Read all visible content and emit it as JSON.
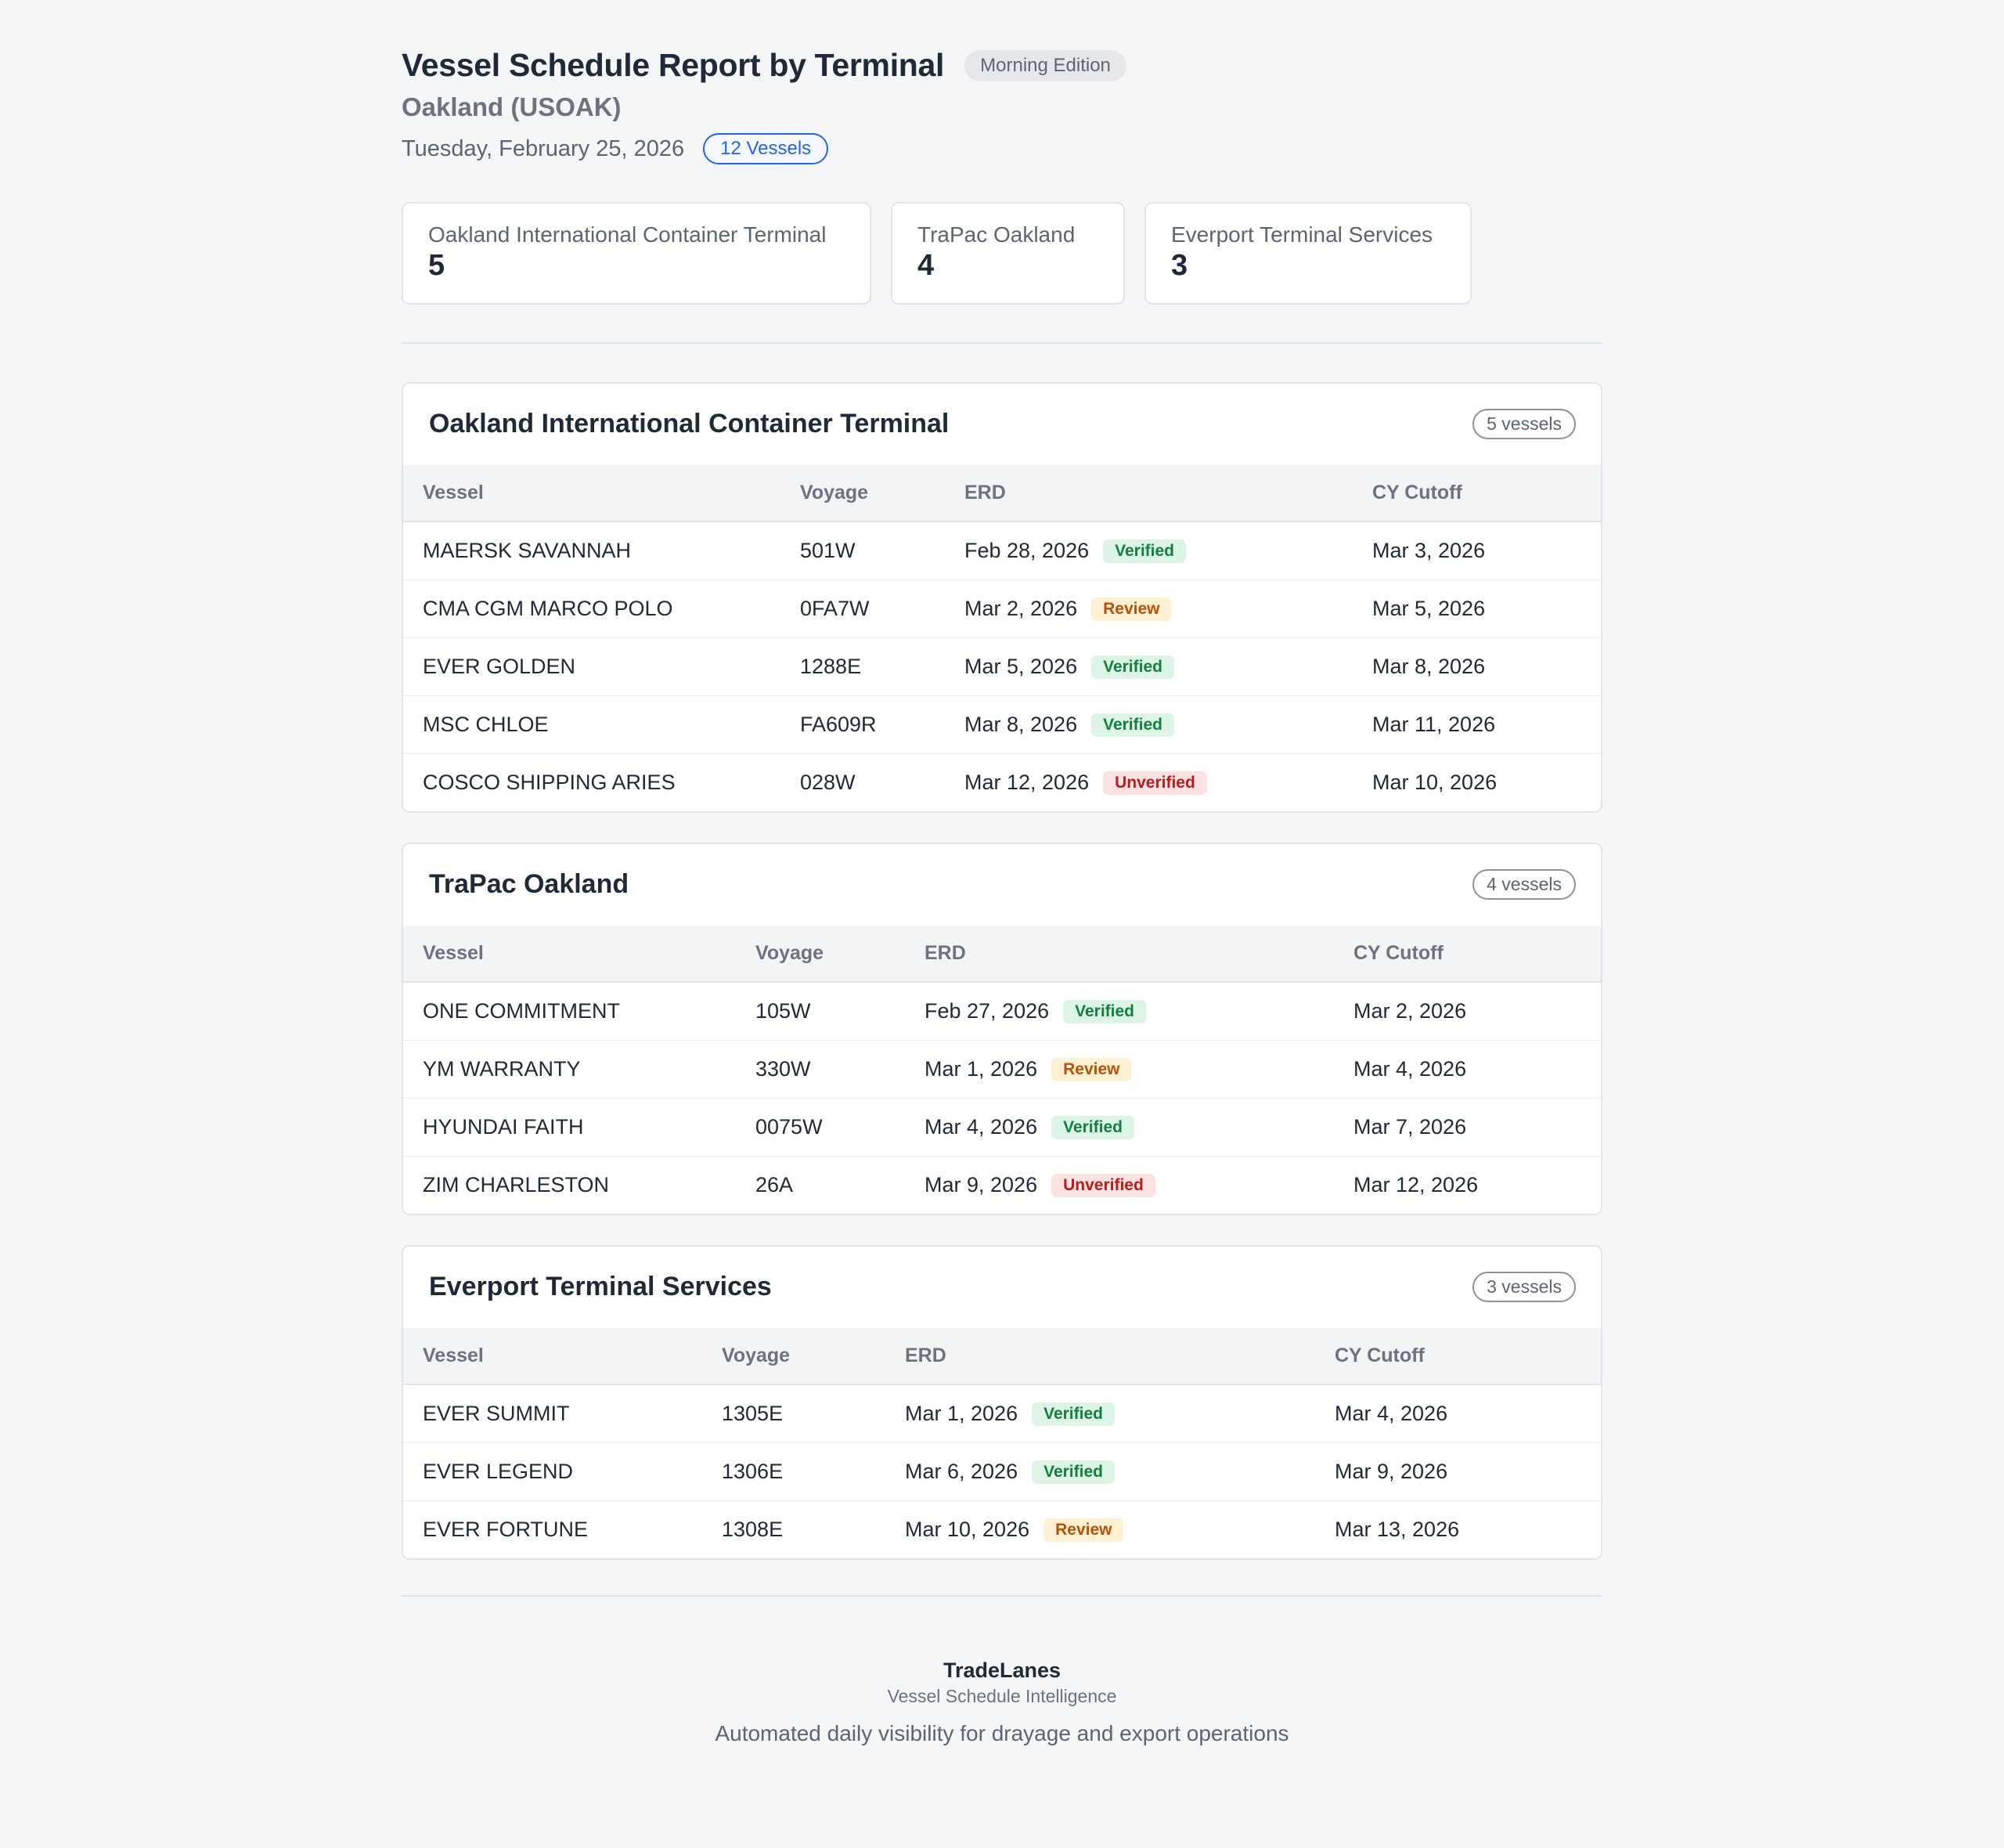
{
  "header": {
    "title": "Vessel Schedule Report by Terminal",
    "edition": "Morning Edition",
    "port": "Oakland (USOAK)",
    "date": "Tuesday, February 25, 2026",
    "vessel_count": "12 Vessels"
  },
  "summary": [
    {
      "name": "Oakland International Container Terminal",
      "count": "5"
    },
    {
      "name": "TraPac Oakland",
      "count": "4"
    },
    {
      "name": "Everport Terminal Services",
      "count": "3"
    }
  ],
  "columns": {
    "vessel": "Vessel",
    "voyage": "Voyage",
    "erd": "ERD",
    "cutoff": "CY Cutoff"
  },
  "terminals": [
    {
      "name": "Oakland International Container Terminal",
      "count": "5 vessels",
      "rows": [
        {
          "vessel": "MAERSK SAVANNAH",
          "voyage": "501W",
          "erd": "Feb 28, 2026",
          "status": "Verified",
          "cutoff": "Mar 3, 2026"
        },
        {
          "vessel": "CMA CGM MARCO POLO",
          "voyage": "0FA7W",
          "erd": "Mar 2, 2026",
          "status": "Review",
          "cutoff": "Mar 5, 2026"
        },
        {
          "vessel": "EVER GOLDEN",
          "voyage": "1288E",
          "erd": "Mar 5, 2026",
          "status": "Verified",
          "cutoff": "Mar 8, 2026"
        },
        {
          "vessel": "MSC CHLOE",
          "voyage": "FA609R",
          "erd": "Mar 8, 2026",
          "status": "Verified",
          "cutoff": "Mar 11, 2026"
        },
        {
          "vessel": "COSCO SHIPPING ARIES",
          "voyage": "028W",
          "erd": "Mar 12, 2026",
          "status": "Unverified",
          "cutoff": "Mar 10, 2026"
        }
      ]
    },
    {
      "name": "TraPac Oakland",
      "count": "4 vessels",
      "rows": [
        {
          "vessel": "ONE COMMITMENT",
          "voyage": "105W",
          "erd": "Feb 27, 2026",
          "status": "Verified",
          "cutoff": "Mar 2, 2026"
        },
        {
          "vessel": "YM WARRANTY",
          "voyage": "330W",
          "erd": "Mar 1, 2026",
          "status": "Review",
          "cutoff": "Mar 4, 2026"
        },
        {
          "vessel": "HYUNDAI FAITH",
          "voyage": "0075W",
          "erd": "Mar 4, 2026",
          "status": "Verified",
          "cutoff": "Mar 7, 2026"
        },
        {
          "vessel": "ZIM CHARLESTON",
          "voyage": "26A",
          "erd": "Mar 9, 2026",
          "status": "Unverified",
          "cutoff": "Mar 12, 2026"
        }
      ]
    },
    {
      "name": "Everport Terminal Services",
      "count": "3 vessels",
      "rows": [
        {
          "vessel": "EVER SUMMIT",
          "voyage": "1305E",
          "erd": "Mar 1, 2026",
          "status": "Verified",
          "cutoff": "Mar 4, 2026"
        },
        {
          "vessel": "EVER LEGEND",
          "voyage": "1306E",
          "erd": "Mar 6, 2026",
          "status": "Verified",
          "cutoff": "Mar 9, 2026"
        },
        {
          "vessel": "EVER FORTUNE",
          "voyage": "1308E",
          "erd": "Mar 10, 2026",
          "status": "Review",
          "cutoff": "Mar 13, 2026"
        }
      ]
    }
  ],
  "footer": {
    "brand": "TradeLanes",
    "subtitle": "Vessel Schedule Intelligence",
    "tagline": "Automated daily visibility for drayage and export operations"
  }
}
